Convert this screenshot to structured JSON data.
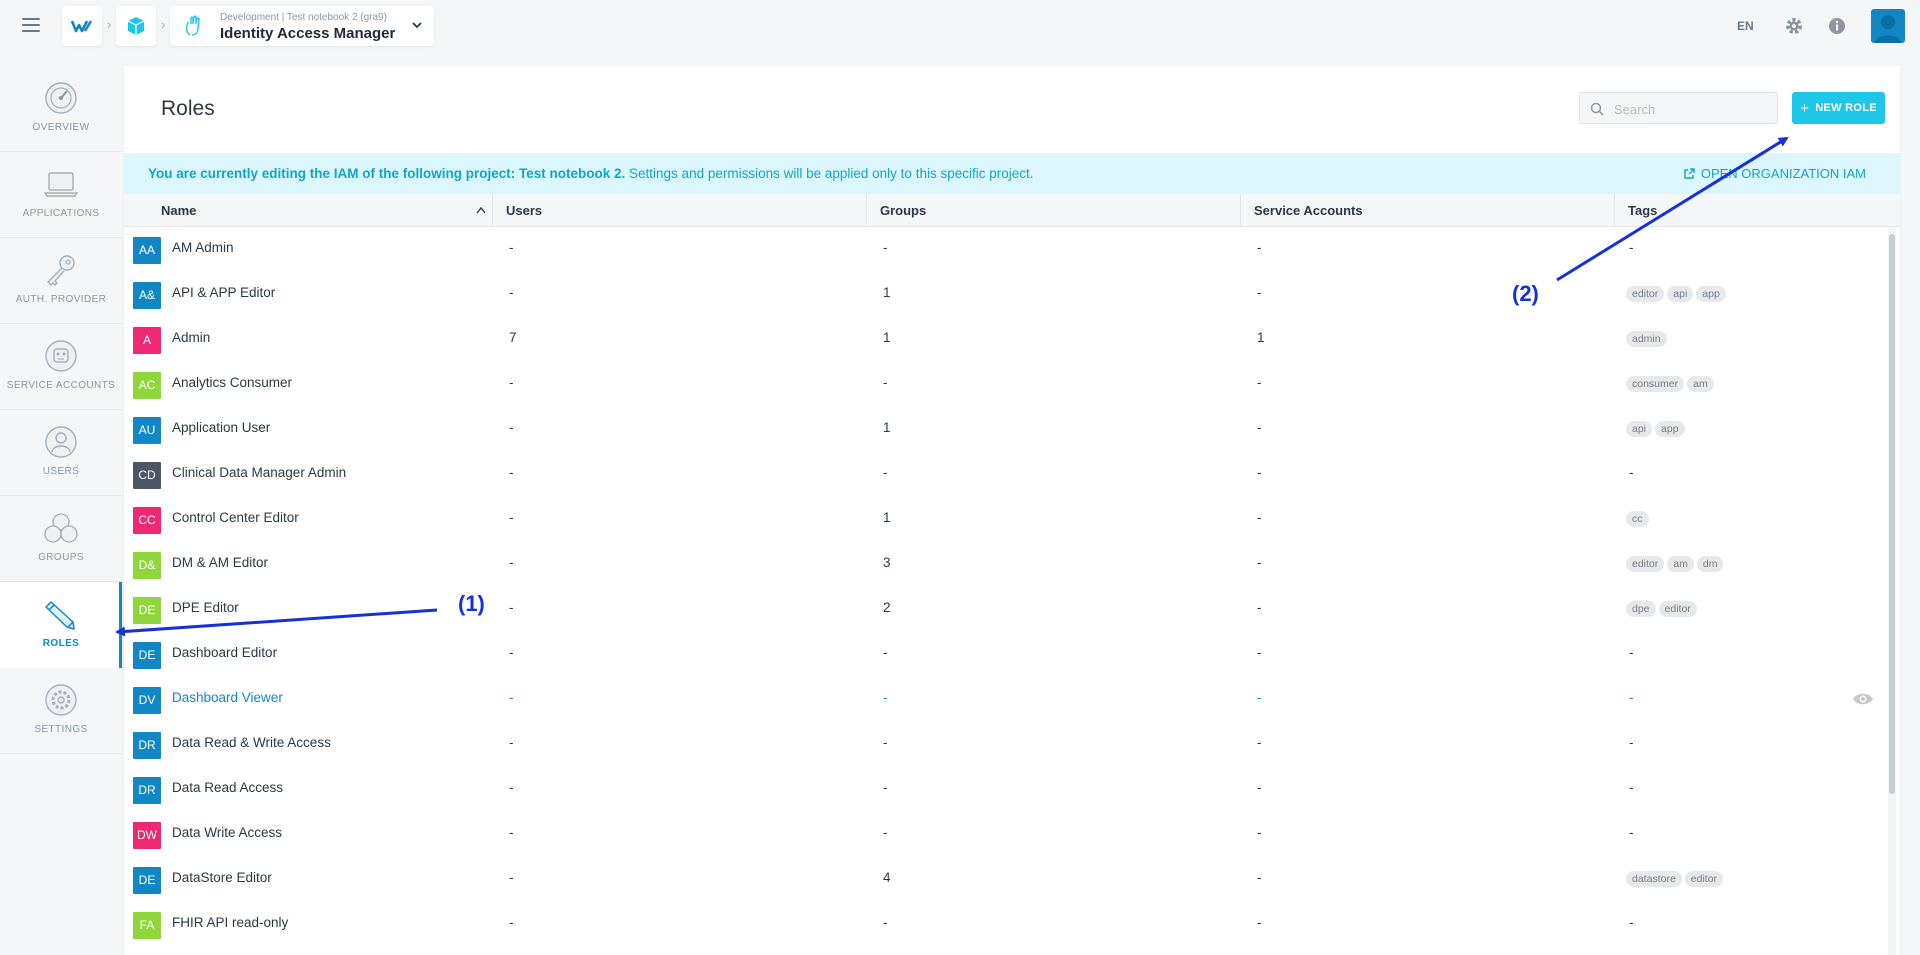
{
  "topbar": {
    "app_subtitle": "Development | Test notebook 2 (gra9)",
    "app_title": "Identity Access Manager",
    "language": "EN",
    "icons": [
      "menu-icon",
      "logo-icon",
      "cube-icon",
      "hand-icon",
      "chevron-down-icon",
      "gear-icon",
      "info-icon",
      "user-avatar-icon"
    ]
  },
  "sidebar": {
    "items": [
      {
        "label": "OVERVIEW",
        "icon": "gauge-icon",
        "active": false
      },
      {
        "label": "APPLICATIONS",
        "icon": "laptop-icon",
        "active": false
      },
      {
        "label": "AUTH. PROVIDER",
        "icon": "key-icon",
        "active": false
      },
      {
        "label": "SERVICE ACCOUNTS",
        "icon": "robot-icon",
        "active": false
      },
      {
        "label": "USERS",
        "icon": "user-icon",
        "active": false
      },
      {
        "label": "GROUPS",
        "icon": "group-icon",
        "active": false
      },
      {
        "label": "ROLES",
        "icon": "pencil-icon",
        "active": true
      },
      {
        "label": "SETTINGS",
        "icon": "settings-icon",
        "active": false
      }
    ]
  },
  "main": {
    "title": "Roles",
    "search_placeholder": "Search",
    "new_role_label": "NEW ROLE",
    "banner": {
      "bold_text": "You are currently editing the IAM of the following project: Test notebook 2.",
      "text": " Settings and permissions will be applied only to this specific project.",
      "link_label": "OPEN ORGANIZATION IAM"
    },
    "columns": [
      "Name",
      "Users",
      "Groups",
      "Service Accounts",
      "Tags"
    ],
    "rows": [
      {
        "initials": "AA",
        "color": "#1188c5",
        "name": "AM Admin",
        "users": "-",
        "groups": "-",
        "service_accounts": "-",
        "tags": []
      },
      {
        "initials": "A&",
        "color": "#1188c5",
        "name": "API & APP Editor",
        "users": "-",
        "groups": "1",
        "service_accounts": "-",
        "tags": [
          "editor",
          "api",
          "app"
        ]
      },
      {
        "initials": "A",
        "color": "#ef2874",
        "name": "Admin",
        "users": "7",
        "groups": "1",
        "service_accounts": "1",
        "tags": [
          "admin"
        ]
      },
      {
        "initials": "AC",
        "color": "#8fd63d",
        "name": "Analytics Consumer",
        "users": "-",
        "groups": "-",
        "service_accounts": "-",
        "tags": [
          "consumer",
          "am"
        ]
      },
      {
        "initials": "AU",
        "color": "#1188c5",
        "name": "Application User",
        "users": "-",
        "groups": "1",
        "service_accounts": "-",
        "tags": [
          "api",
          "app"
        ]
      },
      {
        "initials": "CD",
        "color": "#4d5664",
        "name": "Clinical Data Manager Admin",
        "users": "-",
        "groups": "-",
        "service_accounts": "-",
        "tags": []
      },
      {
        "initials": "CC",
        "color": "#ef2874",
        "name": "Control Center Editor",
        "users": "-",
        "groups": "1",
        "service_accounts": "-",
        "tags": [
          "cc"
        ]
      },
      {
        "initials": "D&",
        "color": "#8fd63d",
        "name": "DM & AM Editor",
        "users": "-",
        "groups": "3",
        "service_accounts": "-",
        "tags": [
          "editor",
          "am",
          "dm"
        ]
      },
      {
        "initials": "DE",
        "color": "#8fd63d",
        "name": "DPE Editor",
        "users": "-",
        "groups": "2",
        "service_accounts": "-",
        "tags": [
          "dpe",
          "editor"
        ]
      },
      {
        "initials": "DE",
        "color": "#1188c5",
        "name": "Dashboard Editor",
        "users": "-",
        "groups": "-",
        "service_accounts": "-",
        "tags": []
      },
      {
        "initials": "DV",
        "color": "#1188c5",
        "name": "Dashboard Viewer",
        "users": "-",
        "groups": "-",
        "service_accounts": "-",
        "tags": [],
        "hover": true
      },
      {
        "initials": "DR",
        "color": "#1188c5",
        "name": "Data Read & Write Access",
        "users": "-",
        "groups": "-",
        "service_accounts": "-",
        "tags": []
      },
      {
        "initials": "DR",
        "color": "#1188c5",
        "name": "Data Read Access",
        "users": "-",
        "groups": "-",
        "service_accounts": "-",
        "tags": []
      },
      {
        "initials": "DW",
        "color": "#ef2874",
        "name": "Data Write Access",
        "users": "-",
        "groups": "-",
        "service_accounts": "-",
        "tags": []
      },
      {
        "initials": "DE",
        "color": "#1188c5",
        "name": "DataStore Editor",
        "users": "-",
        "groups": "4",
        "service_accounts": "-",
        "tags": [
          "datastore",
          "editor"
        ]
      },
      {
        "initials": "FA",
        "color": "#8fd63d",
        "name": "FHIR API read-only",
        "users": "-",
        "groups": "-",
        "service_accounts": "-",
        "tags": []
      }
    ],
    "empty_tags_text": "-"
  },
  "annotations": {
    "label_1": "(1)",
    "label_2": "(2)",
    "color": "#1631d8"
  },
  "colors": {
    "accent": "#1188c5",
    "button": "#1ec6e8",
    "banner_bg": "#dbf6fd"
  }
}
